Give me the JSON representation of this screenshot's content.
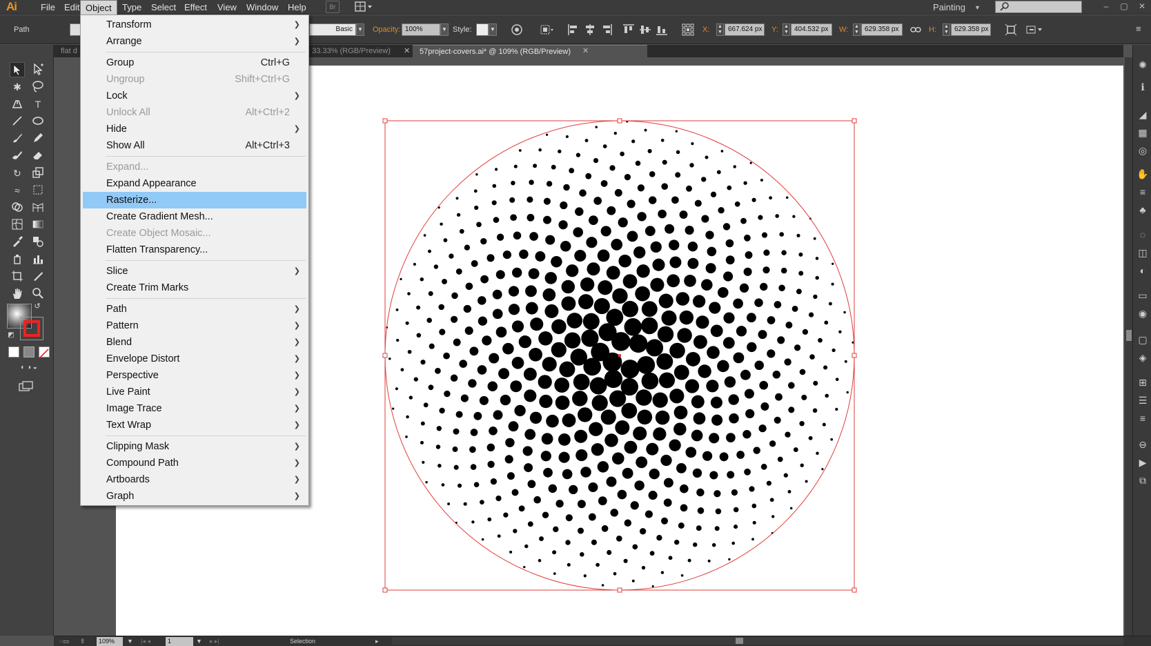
{
  "app": {
    "logo": "Ai"
  },
  "menubar": {
    "items": [
      "File",
      "Edit",
      "Object",
      "Type",
      "Select",
      "Effect",
      "View",
      "Window",
      "Help"
    ],
    "bridge_label": "Br",
    "workspace": "Painting"
  },
  "controlbar": {
    "selection_type": "Path",
    "brush": "Basic",
    "opacity_label": "Opacity:",
    "opacity": "100%",
    "style_label": "Style:",
    "x_label": "X:",
    "x": "667.624 px",
    "y_label": "Y:",
    "y": "404.532 px",
    "w_label": "W:",
    "w": "629.358 px",
    "h_label": "H:",
    "h": "629.358 px"
  },
  "tabs": [
    {
      "label": "flat d"
    },
    {
      "label": "@ 33.33% (RGB/Preview)"
    },
    {
      "label": "57project-covers.ai* @ 109% (RGB/Preview)"
    }
  ],
  "object_menu": {
    "items": [
      {
        "label": "Transform",
        "shortcut": "",
        "submenu": true,
        "disabled": false
      },
      {
        "label": "Arrange",
        "shortcut": "",
        "submenu": true,
        "disabled": false
      },
      {
        "label": "Group",
        "shortcut": "Ctrl+G",
        "submenu": false,
        "disabled": false
      },
      {
        "label": "Ungroup",
        "shortcut": "Shift+Ctrl+G",
        "submenu": false,
        "disabled": true
      },
      {
        "label": "Lock",
        "shortcut": "",
        "submenu": true,
        "disabled": false
      },
      {
        "label": "Unlock All",
        "shortcut": "Alt+Ctrl+2",
        "submenu": false,
        "disabled": true
      },
      {
        "label": "Hide",
        "shortcut": "",
        "submenu": true,
        "disabled": false
      },
      {
        "label": "Show All",
        "shortcut": "Alt+Ctrl+3",
        "submenu": false,
        "disabled": false
      },
      {
        "label": "Expand...",
        "shortcut": "",
        "submenu": false,
        "disabled": true
      },
      {
        "label": "Expand Appearance",
        "shortcut": "",
        "submenu": false,
        "disabled": false
      },
      {
        "label": "Rasterize...",
        "shortcut": "",
        "submenu": false,
        "disabled": false,
        "highlighted": true
      },
      {
        "label": "Create Gradient Mesh...",
        "shortcut": "",
        "submenu": false,
        "disabled": false
      },
      {
        "label": "Create Object Mosaic...",
        "shortcut": "",
        "submenu": false,
        "disabled": true
      },
      {
        "label": "Flatten Transparency...",
        "shortcut": "",
        "submenu": false,
        "disabled": false
      },
      {
        "label": "Slice",
        "shortcut": "",
        "submenu": true,
        "disabled": false
      },
      {
        "label": "Create Trim Marks",
        "shortcut": "",
        "submenu": false,
        "disabled": false
      },
      {
        "label": "Path",
        "shortcut": "",
        "submenu": true,
        "disabled": false
      },
      {
        "label": "Pattern",
        "shortcut": "",
        "submenu": true,
        "disabled": false
      },
      {
        "label": "Blend",
        "shortcut": "",
        "submenu": true,
        "disabled": false
      },
      {
        "label": "Envelope Distort",
        "shortcut": "",
        "submenu": true,
        "disabled": false
      },
      {
        "label": "Perspective",
        "shortcut": "",
        "submenu": true,
        "disabled": false
      },
      {
        "label": "Live Paint",
        "shortcut": "",
        "submenu": true,
        "disabled": false
      },
      {
        "label": "Image Trace",
        "shortcut": "",
        "submenu": true,
        "disabled": false
      },
      {
        "label": "Text Wrap",
        "shortcut": "",
        "submenu": true,
        "disabled": false
      },
      {
        "label": "Clipping Mask",
        "shortcut": "",
        "submenu": true,
        "disabled": false
      },
      {
        "label": "Compound Path",
        "shortcut": "",
        "submenu": true,
        "disabled": false
      },
      {
        "label": "Artboards",
        "shortcut": "",
        "submenu": true,
        "disabled": false
      },
      {
        "label": "Graph",
        "shortcut": "",
        "submenu": true,
        "disabled": false
      }
    ]
  },
  "statusbar": {
    "zoom": "109%",
    "artboard": "1",
    "tool": "Selection"
  },
  "colors": {
    "menu_highlight": "#91c9f7",
    "selection_bbox": "#e23b3b",
    "halftone_dot": "#000000",
    "logo": "#e89528"
  }
}
